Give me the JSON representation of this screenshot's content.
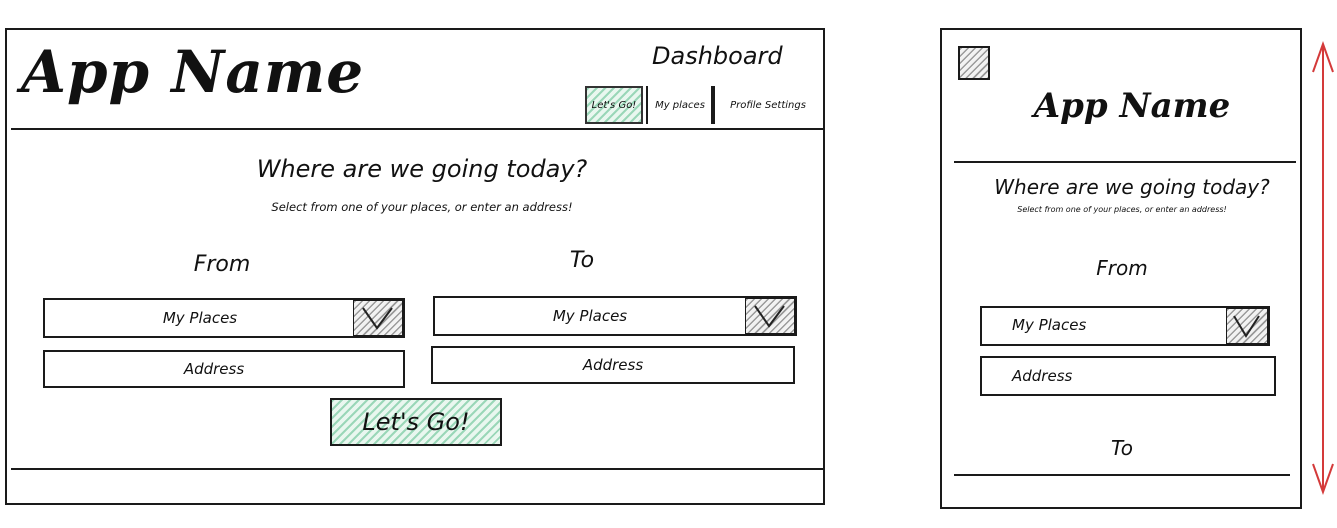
{
  "desktop": {
    "app_name": "App Name",
    "dashboard_label": "Dashboard",
    "nav": [
      "Let's Go!",
      "My places",
      "Profile Settings"
    ],
    "heading": "Where are we going today?",
    "subheading": "Select from one of your places, or enter an address!",
    "from_label": "From",
    "to_label": "To",
    "from_places": "My Places",
    "from_address": "Address",
    "to_places": "My Places",
    "to_address": "Address",
    "go_button": "Let's Go!"
  },
  "mobile": {
    "app_name": "App Name",
    "heading": "Where are we going today?",
    "subheading": "Select from one of your places, or enter an address!",
    "from_label": "From",
    "from_places": "My Places",
    "from_address": "Address",
    "to_label": "To"
  },
  "colors": {
    "accent_hatch": "#9ad7b8",
    "scroll_arrow": "#d43a3a",
    "ink": "#1a1a1a"
  }
}
